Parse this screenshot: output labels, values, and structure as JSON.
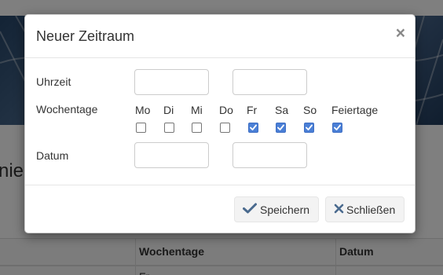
{
  "background": {
    "heading_fragment": "nie",
    "table": {
      "headers": [
        "Wochentage",
        "Datum"
      ],
      "first_cell": "Fr"
    }
  },
  "modal": {
    "title": "Neuer Zeitraum",
    "close_glyph": "×",
    "fields": {
      "uhrzeit_label": "Uhrzeit",
      "wochentage_label": "Wochentage",
      "datum_label": "Datum",
      "uhrzeit_from": "",
      "uhrzeit_to": "",
      "datum_from": "",
      "datum_to": ""
    },
    "weekdays": [
      {
        "label": "Mo",
        "checked": false
      },
      {
        "label": "Di",
        "checked": false
      },
      {
        "label": "Mi",
        "checked": false
      },
      {
        "label": "Do",
        "checked": false
      },
      {
        "label": "Fr",
        "checked": true
      },
      {
        "label": "Sa",
        "checked": true
      },
      {
        "label": "So",
        "checked": true
      },
      {
        "label": "Feiertage",
        "checked": true
      }
    ],
    "buttons": {
      "save_label": "Speichern",
      "save_icon": "checkmark-icon",
      "close_label": "Schließen",
      "close_icon": "x-icon"
    }
  },
  "colors": {
    "checkbox_checked": "#4a7fd6",
    "overlay": "rgba(0,0,0,0.5)"
  }
}
